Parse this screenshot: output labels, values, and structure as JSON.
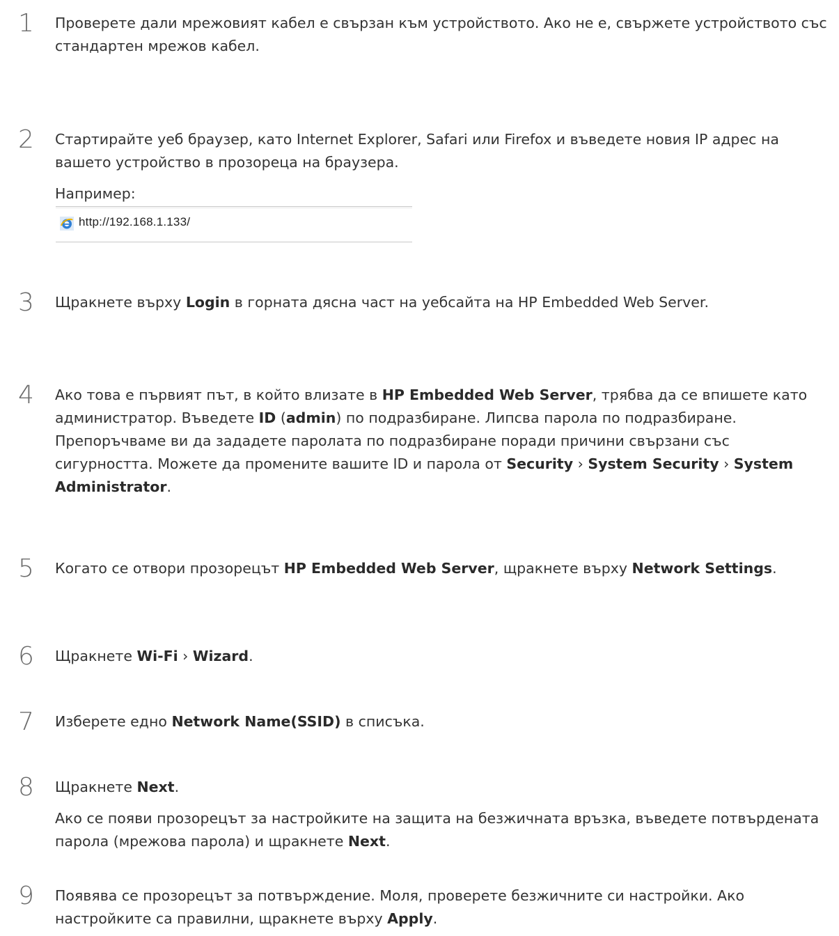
{
  "steps": [
    {
      "n": "1",
      "parts": [
        {
          "t": "Проверете дали мрежовият кабел е свързан към устройството. Ако не е, свържете устройството със стандартен мрежов кабел."
        }
      ]
    },
    {
      "n": "2",
      "parts": [
        {
          "t": "Стартирайте уеб браузер, като Internet Explorer, Safari или Firefox и въведете новия IP адрес на вашето устройство в прозореца на браузера."
        }
      ],
      "example_label": "Например:"
    },
    {
      "n": "3",
      "parts": [
        {
          "t": "Щракнете върху "
        },
        {
          "b": "Login"
        },
        {
          "t": " в горната дясна част на уебсайта на HP Embedded Web Server."
        }
      ]
    },
    {
      "n": "4",
      "parts": [
        {
          "t": "Ако това е първият път, в който влизате в "
        },
        {
          "b": "HP Embedded Web Server"
        },
        {
          "t": ", трябва да се впишете като администратор. Въведете "
        },
        {
          "b": "ID"
        },
        {
          "t": " ("
        },
        {
          "b": "admin"
        },
        {
          "t": ") по подразбиране. Липсва парола по подразбиране. Препоръчваме ви да зададете паролата по подразбиране поради причини свързани със сигурността. Можете да промените вашите ID и парола от "
        },
        {
          "b": "Security"
        },
        {
          "t": " › "
        },
        {
          "b": "System Security"
        },
        {
          "t": " › "
        },
        {
          "b": "System Administrator"
        },
        {
          "t": "."
        }
      ]
    },
    {
      "n": "5",
      "parts": [
        {
          "t": "Когато се отвори прозорецът "
        },
        {
          "b": "HP Embedded Web Server"
        },
        {
          "t": ", щракнете върху "
        },
        {
          "b": "Network Settings"
        },
        {
          "t": "."
        }
      ]
    },
    {
      "n": "6",
      "parts": [
        {
          "t": "Щракнете "
        },
        {
          "b": "Wi-Fi"
        },
        {
          "t": " › "
        },
        {
          "b": "Wizard"
        },
        {
          "t": "."
        }
      ]
    },
    {
      "n": "7",
      "parts": [
        {
          "t": "Изберете едно "
        },
        {
          "b": "Network Name(SSID)"
        },
        {
          "t": " в списъка."
        }
      ]
    },
    {
      "n": "8",
      "parts": [
        {
          "t": "Щракнете "
        },
        {
          "b": "Next"
        },
        {
          "t": "."
        }
      ],
      "sub_parts": [
        {
          "t": "Ако се появи прозорецът за настройките на защита на безжичната връзка, въведете потвърдената парола (мрежова парола) и щракнете "
        },
        {
          "b": "Next"
        },
        {
          "t": "."
        }
      ]
    },
    {
      "n": "9",
      "parts": [
        {
          "t": "Появява се прозорецът за потвърждение. Моля, проверете безжичните си настройки. Ако настройките са правилни, щракнете върху "
        },
        {
          "b": "Apply"
        },
        {
          "t": "."
        }
      ]
    }
  ],
  "example": {
    "icon": "internet-explorer-icon",
    "url": "http://192.168.1.133/"
  }
}
